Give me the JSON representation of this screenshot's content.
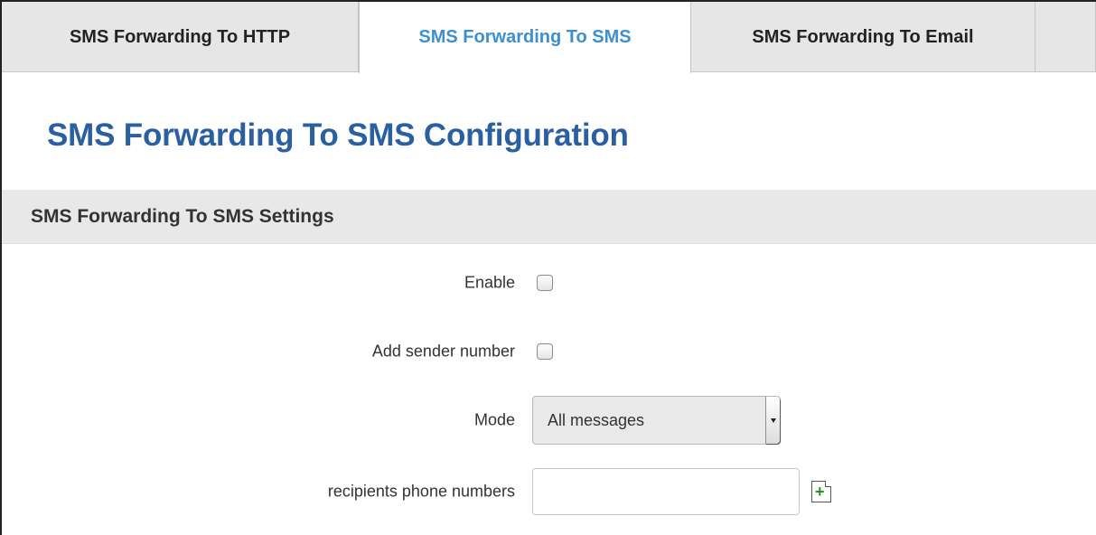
{
  "tabs": [
    {
      "label": "SMS Forwarding To HTTP",
      "active": false
    },
    {
      "label": "SMS Forwarding To SMS",
      "active": true
    },
    {
      "label": "SMS Forwarding To Email",
      "active": false
    }
  ],
  "page_title": "SMS Forwarding To SMS Configuration",
  "section_title": "SMS Forwarding To SMS Settings",
  "form": {
    "enable": {
      "label": "Enable",
      "checked": false
    },
    "add_sender": {
      "label": "Add sender number",
      "checked": false
    },
    "mode": {
      "label": "Mode",
      "value": "All messages"
    },
    "recipients": {
      "label": "recipients phone numbers",
      "value": "",
      "add_icon": "add-file-icon"
    }
  },
  "colors": {
    "active_tab_text": "#3d8fd0",
    "title": "#2a5fa0",
    "add_icon_plus": "#1a9b1a"
  }
}
